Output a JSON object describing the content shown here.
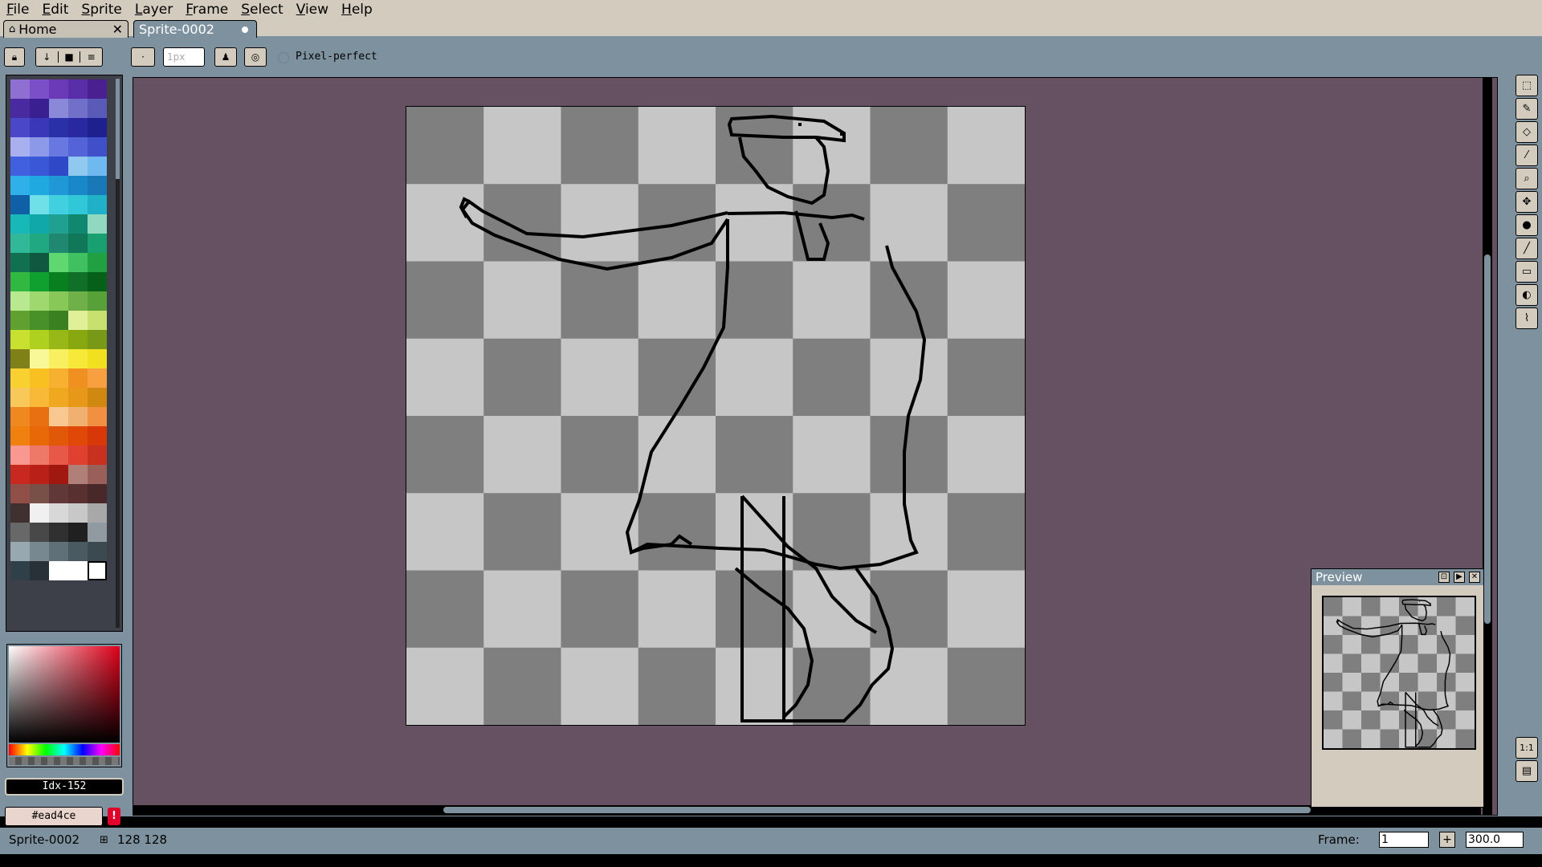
{
  "menu": [
    "File",
    "Edit",
    "Sprite",
    "Layer",
    "Frame",
    "Select",
    "View",
    "Help"
  ],
  "tabs": {
    "home_label": "Home",
    "sprite_label": "Sprite-0002"
  },
  "context_bar": {
    "brush_size_placeholder": "1px",
    "pixel_perfect_label": "Pixel-perfect"
  },
  "palette": {
    "colors": [
      "#8f6fd1",
      "#7a4fc8",
      "#6a3ab8",
      "#5a2ea8",
      "#4a2090",
      "#4a2aa0",
      "#3a1f90",
      "#8a88d8",
      "#7070c8",
      "#5a5ab8",
      "#4a48c8",
      "#3a38b8",
      "#2a30a8",
      "#2a28a0",
      "#1e2090",
      "#a8b0f0",
      "#8c98e8",
      "#6878e0",
      "#5464d8",
      "#4050c8",
      "#4060e0",
      "#3858d8",
      "#2f48c8",
      "#90c8f0",
      "#70b8f0",
      "#30b0e8",
      "#20a8e0",
      "#2098d8",
      "#1888c8",
      "#1878b8",
      "#1060a8",
      "#70e0e8",
      "#40d0e0",
      "#30c8d8",
      "#20b0c8",
      "#18b8b8",
      "#10a8a8",
      "#20a090",
      "#108870",
      "#90d8c0",
      "#30b898",
      "#20a880",
      "#208870",
      "#107858",
      "#18a070",
      "#107050",
      "#105840",
      "#60d870",
      "#40c060",
      "#20a040",
      "#30b840",
      "#10a030",
      "#088020",
      "#107028",
      "#066018",
      "#b8e890",
      "#a0d870",
      "#88c858",
      "#70b048",
      "#58a038",
      "#60a030",
      "#489028",
      "#3a8020",
      "#e0f098",
      "#c8e070",
      "#c8e030",
      "#b0d020",
      "#98b818",
      "#88a810",
      "#789818",
      "#808018",
      "#f8f898",
      "#f8f060",
      "#f8e838",
      "#f0e020",
      "#f8d030",
      "#f8c020",
      "#f8b030",
      "#f09020",
      "#f8a040",
      "#f8c858",
      "#f8b838",
      "#f0a820",
      "#e89818",
      "#d08810",
      "#f08820",
      "#e87010",
      "#f8c890",
      "#f0b070",
      "#f09040",
      "#f08010",
      "#e86808",
      "#e05808",
      "#e04808",
      "#d83808",
      "#f89890",
      "#f07868",
      "#e85848",
      "#e04030",
      "#c83020",
      "#c82820",
      "#b82018",
      "#a01810",
      "#b08078",
      "#986058",
      "#905048",
      "#785048",
      "#603838",
      "#583030",
      "#482828",
      "#403030",
      "#f0f0f0",
      "#d8d8d8",
      "#c8c8c8",
      "#a8a8a8",
      "#686868",
      "#484848",
      "#303030",
      "#202020",
      "#909aa0",
      "#98a8b0",
      "#788890",
      "#607078",
      "#4a5a60",
      "#3a4a50",
      "#304048",
      "#283038",
      "#FFFFFF",
      "#ffffff",
      "sel"
    ]
  },
  "index_field": "Idx-152",
  "hex_field": "#ead4ce",
  "warning_icon": "!",
  "preview": {
    "title": "Preview"
  },
  "tools": [
    "rectangular-marquee",
    "pencil",
    "eraser",
    "eyedropper",
    "zoom",
    "move",
    "paint-bucket",
    "line",
    "rectangle",
    "contour",
    "blur"
  ],
  "zoom_buttons": [
    "1:1",
    "▤"
  ],
  "status": {
    "sprite_name": "Sprite-0002",
    "size": "128 128",
    "frame_label": "Frame:",
    "frame_value": "1",
    "frame_add": "+",
    "zoom_value": "300.0"
  },
  "colors": {
    "ui_beige": "#d3cbbe",
    "ui_blue_gray": "#7d929e",
    "editor_bg": "#655161",
    "checker_light": "#c6c6c6",
    "checker_dark": "#7f7f7f"
  }
}
